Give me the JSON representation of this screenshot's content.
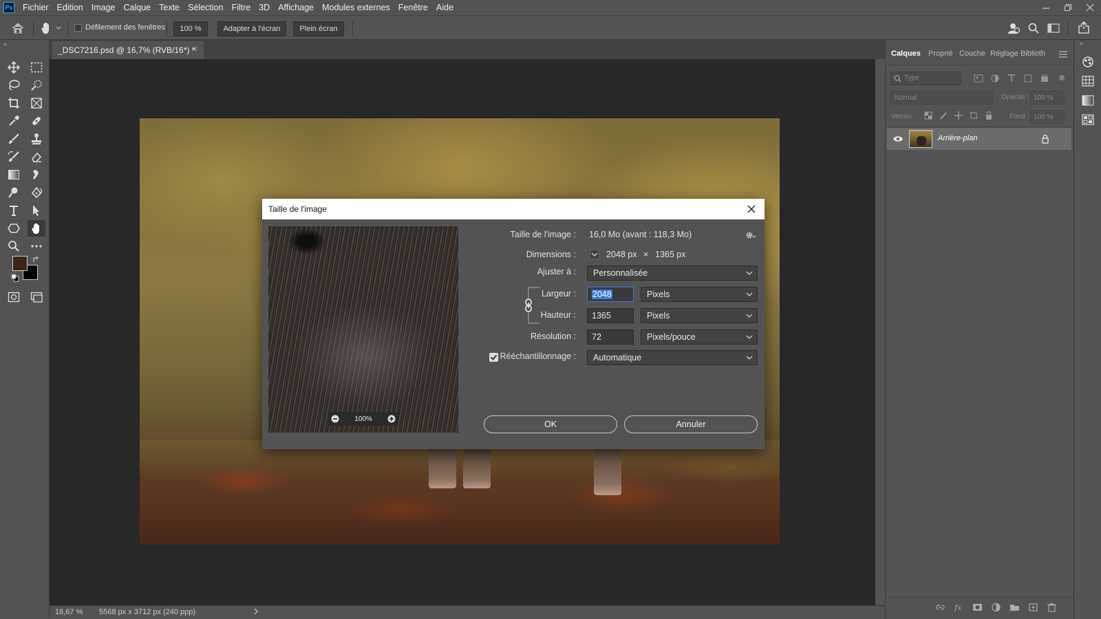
{
  "menu": {
    "logo": "Ps",
    "items": [
      "Fichier",
      "Edition",
      "Image",
      "Calque",
      "Texte",
      "Sélection",
      "Filtre",
      "3D",
      "Affichage",
      "Modules externes",
      "Fenêtre",
      "Aide"
    ]
  },
  "options": {
    "scroll_all_windows": "Défilement des fenêtres",
    "zoom_100": "100 %",
    "fit_screen": "Adapter à l'écran",
    "full_screen": "Plein écran"
  },
  "document": {
    "tab_title": "_DSC7216.psd @ 16,7% (RVB/16*) *"
  },
  "status": {
    "zoom": "16,67 %",
    "doc_info": "5568 px x 3712 px (240 ppp)"
  },
  "layers_panel": {
    "tabs": [
      "Calques",
      "Proprié",
      "Couche",
      "Réglage",
      "Biblioth"
    ],
    "filter_placeholder": "Type",
    "blend_mode": "Normal",
    "opacity_label": "Opacité :",
    "opacity_value": "100 %",
    "lock_label": "Verrou :",
    "fill_label": "Fond :",
    "fill_value": "100 %",
    "layer_name": "Arrière-plan"
  },
  "dialog": {
    "title": "Taille de l'image",
    "image_size_label": "Taille de l'image :",
    "image_size_value": "16,0 Mo (avant : 118,3 Mo)",
    "dimensions_label": "Dimensions :",
    "dim_width": "2048 px",
    "dim_times": "×",
    "dim_height": "1365 px",
    "fit_to_label": "Ajuster à :",
    "fit_to_value": "Personnalisée",
    "width_label": "Largeur :",
    "width_value": "2048",
    "width_unit": "Pixels",
    "height_label": "Hauteur :",
    "height_value": "1365",
    "height_unit": "Pixels",
    "resolution_label": "Résolution :",
    "resolution_value": "72",
    "resolution_unit": "Pixels/pouce",
    "resample_label": "Rééchantillonnage :",
    "resample_value": "Automatique",
    "preview_zoom": "100%",
    "ok": "OK",
    "cancel": "Annuler"
  },
  "colors": {
    "ui_bg": "#535353",
    "canvas_bg": "#282828",
    "highlight": "#3a7bd5",
    "foreground_swatch": "#3a2518",
    "background_swatch": "#000000"
  }
}
